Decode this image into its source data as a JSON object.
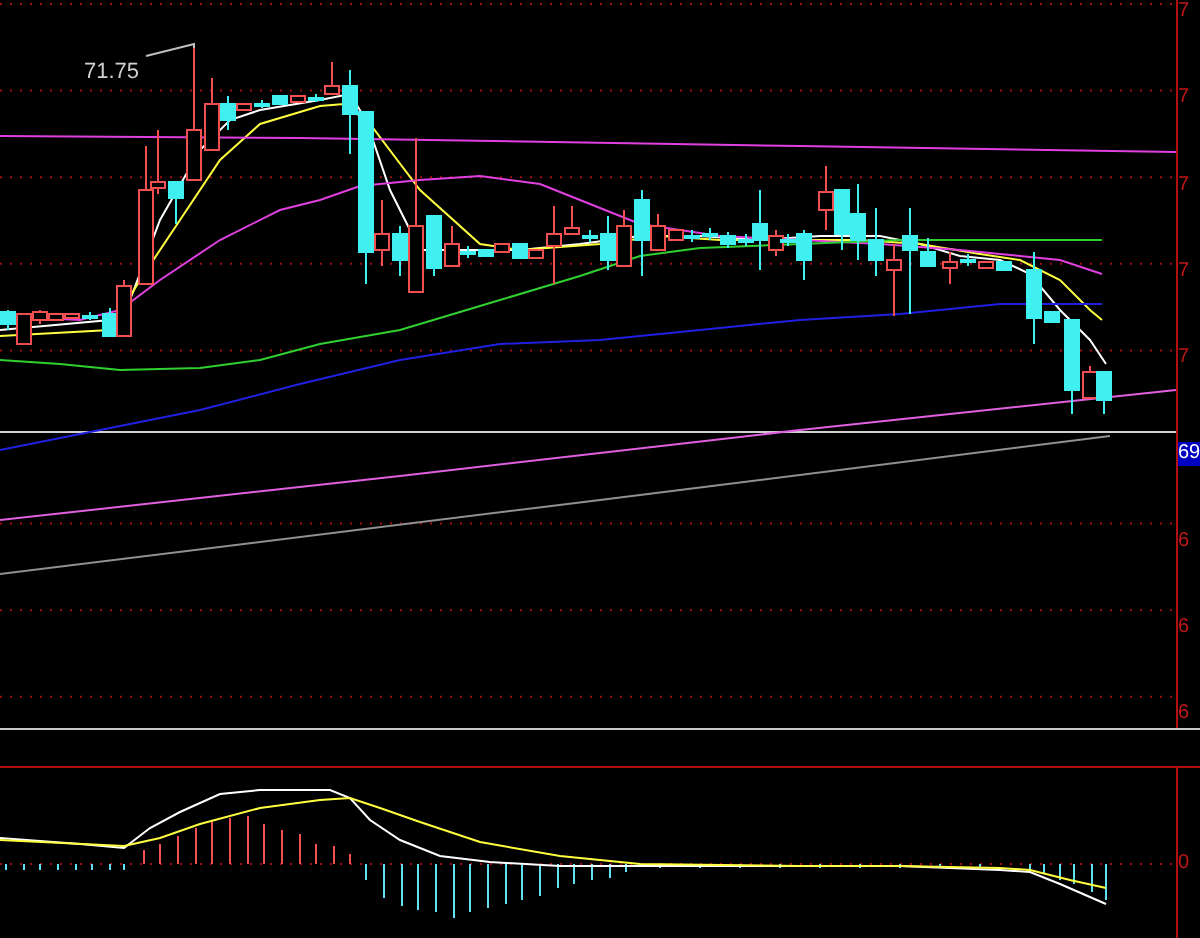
{
  "price_panel": {
    "high_label": "71.75",
    "axis_labels": [
      {
        "text": "7",
        "kind": "tick"
      },
      {
        "text": "7",
        "kind": "tick"
      },
      {
        "text": "7",
        "kind": "tick"
      },
      {
        "text": "7",
        "kind": "tick"
      },
      {
        "text": "7",
        "kind": "tick"
      },
      {
        "text": "69",
        "kind": "current"
      },
      {
        "text": "6",
        "kind": "tick"
      },
      {
        "text": "6",
        "kind": "tick"
      },
      {
        "text": "6",
        "kind": "tick"
      }
    ]
  },
  "macd_panel": {
    "axis_labels": [
      "0"
    ]
  }
}
